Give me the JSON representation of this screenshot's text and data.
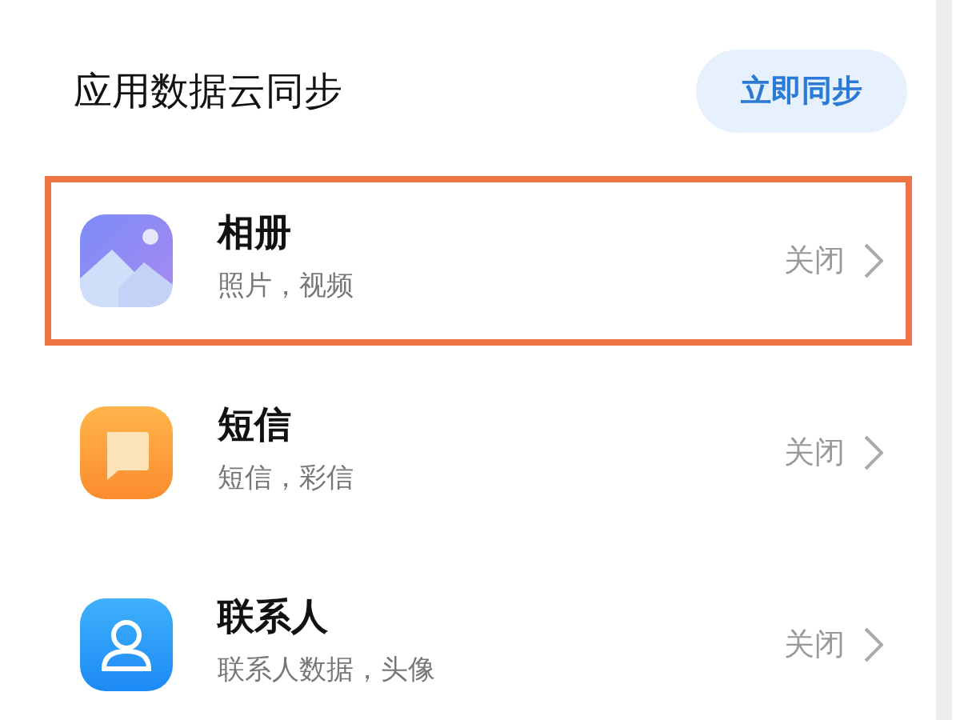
{
  "section": {
    "title": "应用数据云同步",
    "sync_button": "立即同步"
  },
  "items": [
    {
      "kind": "gallery",
      "title": "相册",
      "subtitle": "照片，视频",
      "status": "关闭",
      "highlighted": true
    },
    {
      "kind": "message",
      "title": "短信",
      "subtitle": "短信，彩信",
      "status": "关闭",
      "highlighted": false
    },
    {
      "kind": "contacts",
      "title": "联系人",
      "subtitle": "联系人数据，头像",
      "status": "关闭",
      "highlighted": false
    }
  ]
}
